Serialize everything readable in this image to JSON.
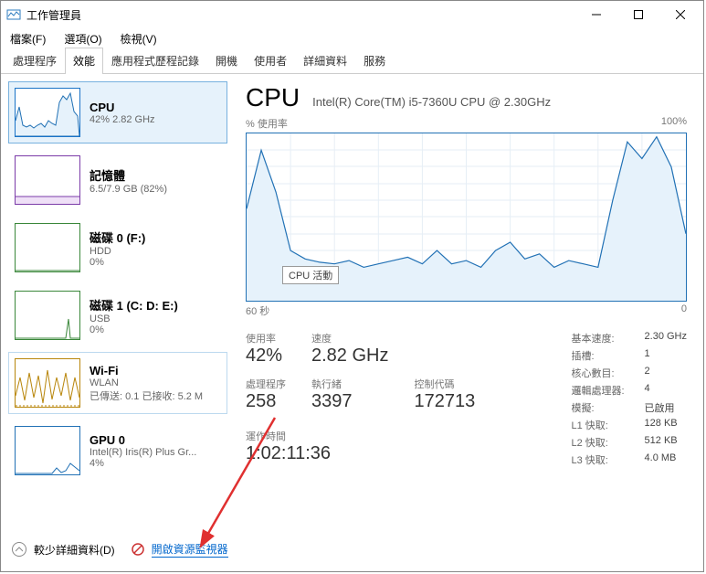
{
  "window": {
    "title": "工作管理員"
  },
  "menu": {
    "file": "檔案(F)",
    "options": "選項(O)",
    "view": "檢視(V)"
  },
  "tabs": {
    "processes": "處理程序",
    "performance": "效能",
    "history": "應用程式歷程記錄",
    "startup": "開機",
    "users": "使用者",
    "details": "詳細資料",
    "services": "服務"
  },
  "sidebar": {
    "items": [
      {
        "name": "CPU",
        "sub": "42%  2.82 GHz"
      },
      {
        "name": "記憶體",
        "sub": "6.5/7.9 GB (82%)"
      },
      {
        "name": "磁碟 0 (F:)",
        "sub": "HDD",
        "val": "0%"
      },
      {
        "name": "磁碟 1 (C: D: E:)",
        "sub": "USB",
        "val": "0%"
      },
      {
        "name": "Wi-Fi",
        "sub": "WLAN",
        "val": "已傳送: 0.1  已接收: 5.2 M"
      },
      {
        "name": "GPU 0",
        "sub": "Intel(R) Iris(R) Plus Gr...",
        "val": "4%"
      }
    ]
  },
  "main": {
    "title": "CPU",
    "model": "Intel(R) Core(TM) i5-7360U CPU @ 2.30GHz",
    "y_label": "% 使用率",
    "y_max": "100%",
    "x_left": "60 秒",
    "x_right": "0",
    "tooltip": "CPU 活動",
    "left_stats": {
      "util_lbl": "使用率",
      "util_val": "42%",
      "speed_lbl": "速度",
      "speed_val": "2.82 GHz",
      "proc_lbl": "處理程序",
      "proc_val": "258",
      "threads_lbl": "執行緒",
      "threads_val": "3397",
      "handles_lbl": "控制代碼",
      "handles_val": "172713"
    },
    "uptime_lbl": "運作時間",
    "uptime_val": "1:02:11:36",
    "right_stats": {
      "k0": "基本速度:",
      "v0": "2.30 GHz",
      "k1": "插槽:",
      "v1": "1",
      "k2": "核心數目:",
      "v2": "2",
      "k3": "邏輯處理器:",
      "v3": "4",
      "k4": "模擬:",
      "v4": "已啟用",
      "k5": "L1 快取:",
      "v5": "128 KB",
      "k6": "L2 快取:",
      "v6": "512 KB",
      "k7": "L3 快取:",
      "v7": "4.0 MB"
    }
  },
  "footer": {
    "less": "較少詳細資料(D)",
    "resmon": "開啟資源監視器"
  },
  "chart_data": {
    "type": "line",
    "title": "CPU % 使用率",
    "xlabel": "秒",
    "ylabel": "% 使用率",
    "x": [
      60,
      58,
      56,
      54,
      52,
      50,
      48,
      46,
      44,
      42,
      40,
      38,
      36,
      34,
      32,
      30,
      28,
      26,
      24,
      22,
      20,
      18,
      16,
      14,
      12,
      10,
      8,
      6,
      4,
      2,
      0
    ],
    "values": [
      55,
      90,
      65,
      30,
      25,
      23,
      22,
      24,
      20,
      22,
      24,
      26,
      22,
      30,
      22,
      24,
      20,
      30,
      35,
      25,
      28,
      20,
      24,
      22,
      20,
      60,
      95,
      85,
      98,
      80,
      40
    ],
    "ylim": [
      0,
      100
    ],
    "xlim": [
      60,
      0
    ]
  }
}
